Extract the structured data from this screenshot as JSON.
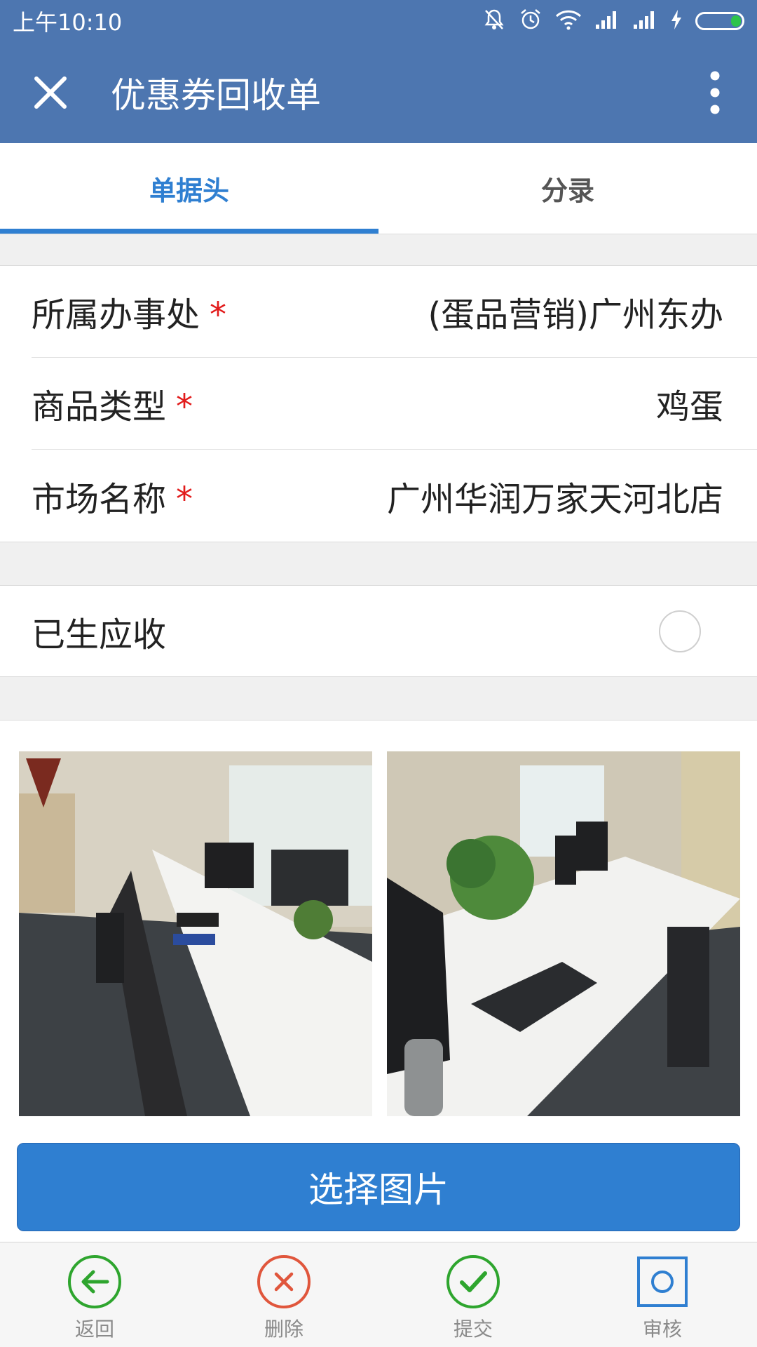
{
  "status_bar": {
    "time": "上午10:10",
    "battery_color": "#2ec44a"
  },
  "header": {
    "title": "优惠券回收单",
    "close_icon": "close-icon",
    "more_icon": "more-vertical-icon",
    "background": "#4d76b0"
  },
  "tabs": [
    {
      "label": "单据头",
      "active": true
    },
    {
      "label": "分录",
      "active": false
    }
  ],
  "form": {
    "rows": [
      {
        "label": "所属办事处",
        "required": "*",
        "value": "(蛋品营销)广州东办"
      },
      {
        "label": "商品类型",
        "required": "*",
        "value": "鸡蛋"
      },
      {
        "label": "市场名称",
        "required": "*",
        "value": "广州华润万家天河北店"
      }
    ]
  },
  "toggle": {
    "label": "已生应收",
    "checked": false
  },
  "photos": [
    {
      "icon": "office-photo"
    },
    {
      "icon": "office-photo"
    }
  ],
  "select_button": {
    "label": "选择图片",
    "color": "#2f7fd1"
  },
  "toolbar": {
    "back": {
      "label": "返回",
      "color": "#2ea52e"
    },
    "delete": {
      "label": "删除",
      "color": "#e0563c"
    },
    "submit": {
      "label": "提交",
      "color": "#2ea52e"
    },
    "audit": {
      "label": "审核",
      "color": "#2f7fd1"
    }
  }
}
